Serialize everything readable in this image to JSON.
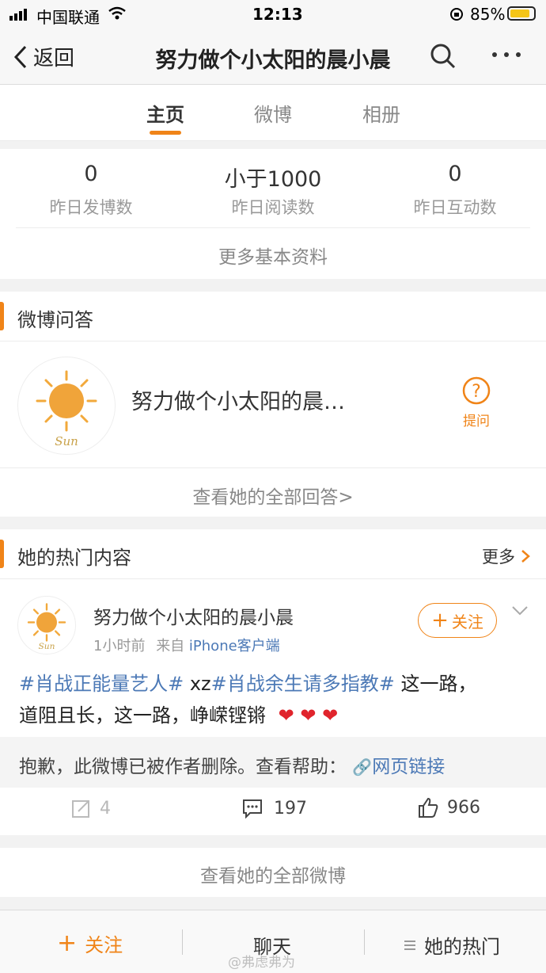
{
  "status": {
    "carrier": "中国联通",
    "time": "12:13",
    "battery": "85%"
  },
  "nav": {
    "back": "返回",
    "title": "努力做个小太阳的晨小晨"
  },
  "tabs": [
    "主页",
    "微博",
    "相册"
  ],
  "stats": [
    {
      "value": "0",
      "label": "昨日发博数"
    },
    {
      "value": "小于1000",
      "label": "昨日阅读数"
    },
    {
      "value": "0",
      "label": "昨日互动数"
    }
  ],
  "more_profile": "更多基本资料",
  "qa": {
    "title": "微博问答",
    "name": "努力做个小太阳的晨…",
    "ask": "提问",
    "view_all": "查看她的全部回答>",
    "avatar_text": "Sun"
  },
  "hot": {
    "title": "她的热门内容",
    "more": "更多"
  },
  "post": {
    "author": "努力做个小太阳的晨小晨",
    "time": "1小时前",
    "source_prefix": "来自",
    "source": "iPhone客户端",
    "follow": "关注",
    "tag1": "#肖战正能量艺人#",
    "mid": " xz",
    "tag2": "#肖战余生请多指教#",
    "text1": " 这一路，",
    "text2": "道阻且长，这一路，峥嵘铿锵",
    "deleted": "抱歉，此微博已被作者删除。查看帮助：",
    "link": "网页链接",
    "reposts": "4",
    "comments": "197",
    "likes": "966"
  },
  "view_all_weibo": "查看她的全部微博",
  "bottom": {
    "follow": "关注",
    "chat": "聊天",
    "hot": "她的热门"
  },
  "watermark": "@弗虑弗为",
  "colors": {
    "accent": "#f08418",
    "link": "#4c79b6"
  }
}
